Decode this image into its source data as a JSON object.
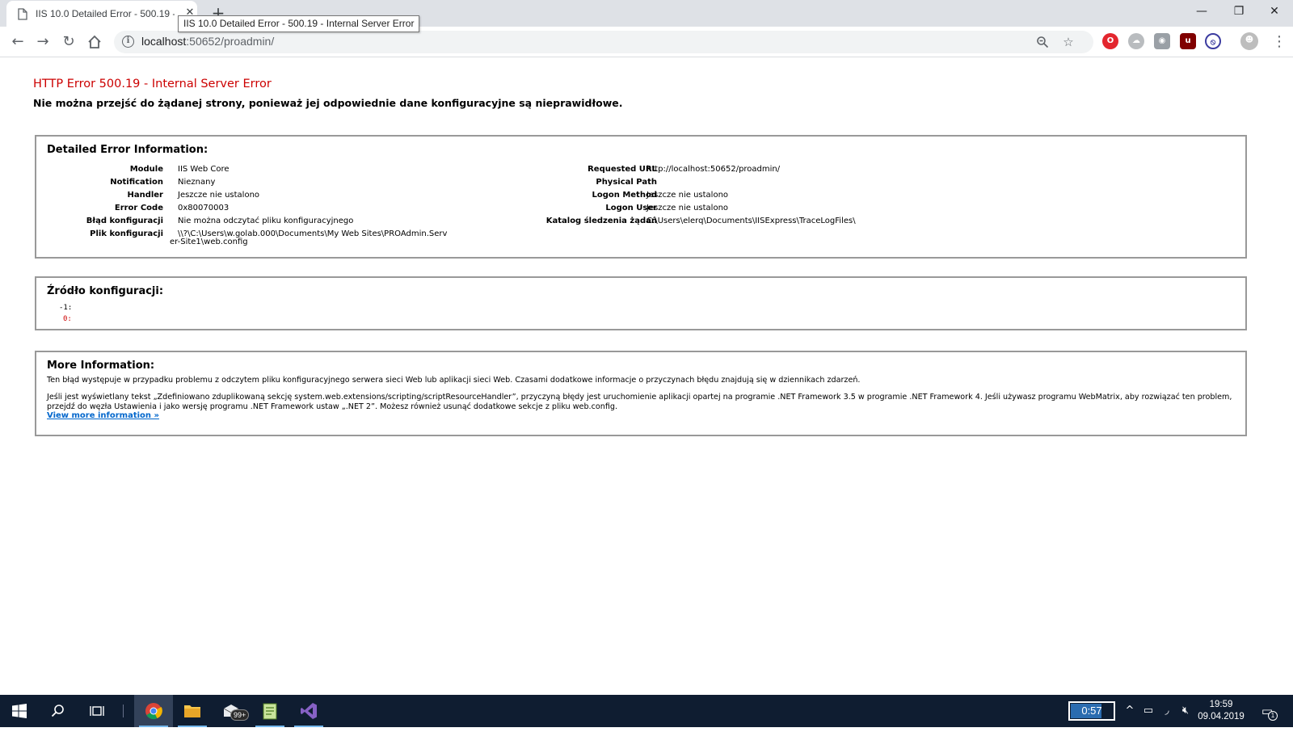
{
  "browser": {
    "tab_title": "IIS 10.0 Detailed Error - 500.19 -",
    "tooltip": "IIS 10.0 Detailed Error - 500.19 - Internal Server Error",
    "url_host": "localhost",
    "url_rest": ":50652/proadmin/",
    "window_minimize": "—",
    "window_restore": "❐",
    "window_close": "✕",
    "new_tab": "+"
  },
  "page": {
    "title": "HTTP Error 500.19 - Internal Server Error",
    "subtitle": "Nie można przejść do żądanej strony, ponieważ jej odpowiednie dane konfiguracyjne są nieprawidłowe.",
    "detailed": {
      "heading": "Detailed Error Information:",
      "left": [
        {
          "label": "Module",
          "value": "IIS Web Core"
        },
        {
          "label": "Notification",
          "value": "Nieznany"
        },
        {
          "label": "Handler",
          "value": "Jeszcze nie ustalono"
        },
        {
          "label": "Error Code",
          "value": "0x80070003"
        },
        {
          "label": "Błąd konfiguracji",
          "value": "Nie można odczytać pliku konfiguracyjnego"
        },
        {
          "label": "Plik konfiguracji",
          "value": "\\\\?\\C:\\Users\\w.golab.000\\Documents\\My Web Sites\\PROAdmin.Serv",
          "value2": "er-Site1\\web.config"
        }
      ],
      "right": [
        {
          "label": "Requested URL",
          "value": "http://localhost:50652/proadmin/"
        },
        {
          "label": "Physical Path",
          "value": ""
        },
        {
          "label": "Logon Method",
          "value": "Jeszcze nie ustalono"
        },
        {
          "label": "Logon User",
          "value": "Jeszcze nie ustalono"
        },
        {
          "label": "Katalog śledzenia żądań",
          "value": "C:\\Users\\elerq\\Documents\\IISExpress\\TraceLogFiles\\"
        }
      ]
    },
    "config_source": {
      "heading": "Źródło konfiguracji:",
      "lines": [
        "-1:",
        "0:"
      ]
    },
    "more_info": {
      "heading": "More Information:",
      "para1": "Ten błąd występuje w przypadku problemu z odczytem pliku konfiguracyjnego serwera sieci Web lub aplikacji sieci Web. Czasami dodatkowe informacje o przyczynach błędu znajdują się w dziennikach zdarzeń.",
      "para2": "Jeśli jest wyświetlany tekst „Zdefiniowano zduplikowaną sekcję system.web.extensions/scripting/scriptResourceHandler”, przyczyną błędy jest uruchomienie aplikacji opartej na programie .NET Framework 3.5 w programie .NET Framework 4. Jeśli używasz programu WebMatrix, aby rozwiązać ten problem, przejdź do węzła Ustawienia i jako wersję programu .NET Framework ustaw „.NET 2”. Możesz również usunąć dodatkowe sekcje z pliku web.config.",
      "link": "View more information »"
    }
  },
  "taskbar": {
    "mail_badge": "99+",
    "battery_time": "0:57",
    "battery_level": 0.7,
    "time": "19:59",
    "date": "09.04.2019",
    "notification_count": "1"
  },
  "colors": {
    "error_title": "#cc0000",
    "link": "#0066cc",
    "taskbar": "#0f1d31"
  }
}
